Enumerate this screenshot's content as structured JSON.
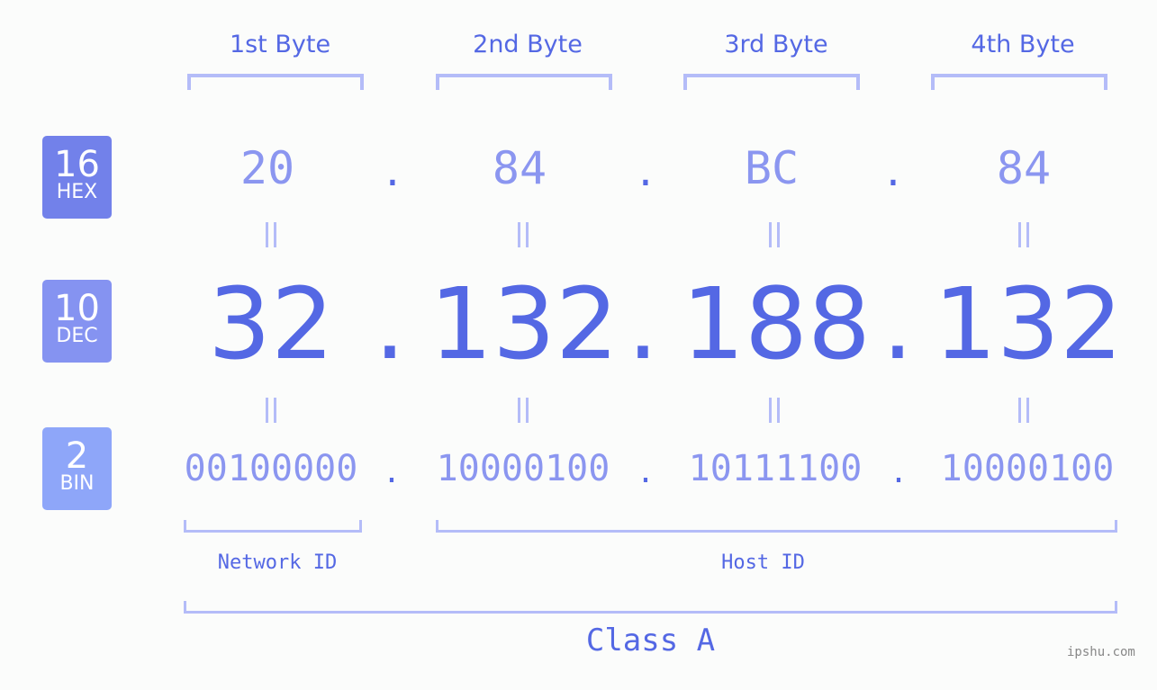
{
  "badges": [
    {
      "number": "16",
      "label": "HEX",
      "color": "#7281ea"
    },
    {
      "number": "10",
      "label": "DEC",
      "color": "#8593f1"
    },
    {
      "number": "2",
      "label": "BIN",
      "color": "#8ea6f9"
    }
  ],
  "bytes": [
    {
      "header": "1st Byte",
      "hex": "20",
      "dec": "32",
      "bin": "00100000"
    },
    {
      "header": "2nd Byte",
      "hex": "84",
      "dec": "132",
      "bin": "10000100"
    },
    {
      "header": "3rd Byte",
      "hex": "BC",
      "dec": "188",
      "bin": "10111100"
    },
    {
      "header": "4th Byte",
      "hex": "84",
      "dec": "132",
      "bin": "10000100"
    }
  ],
  "separator": ".",
  "labels": {
    "network_id": "Network ID",
    "host_id": "Host ID",
    "class": "Class A"
  },
  "watermark": "ipshu.com",
  "colors": {
    "primary": "#5468e4",
    "light": "#8b96f0",
    "bracket": "#b4bcf8"
  }
}
